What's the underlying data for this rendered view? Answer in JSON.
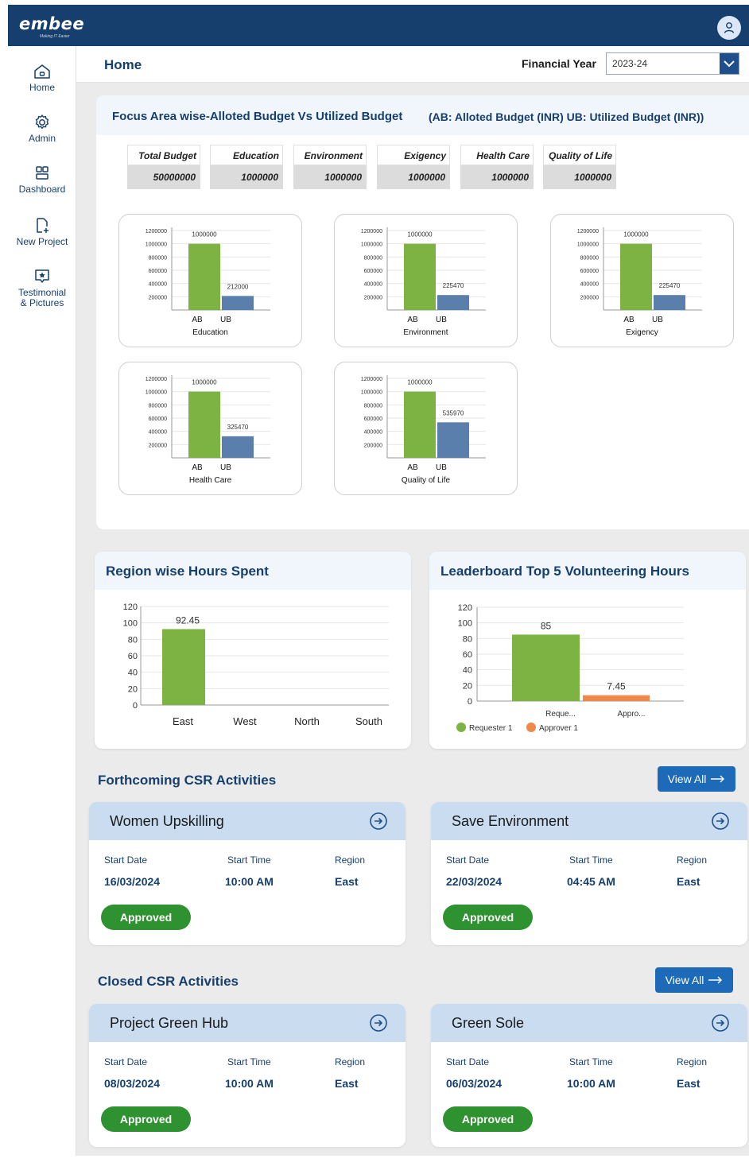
{
  "app": {
    "logo": "embee",
    "tagline": "Making IT Easier"
  },
  "sidebar": {
    "items": [
      {
        "label": "Home",
        "icon": "home-icon"
      },
      {
        "label": "Admin",
        "icon": "gear-icon"
      },
      {
        "label": "Dashboard",
        "icon": "dashboard-icon"
      },
      {
        "label": "New Project",
        "icon": "new-file-icon"
      },
      {
        "label": "Testimonial",
        "label2": "& Pictures",
        "icon": "star-message-icon"
      }
    ]
  },
  "header": {
    "title": "Home",
    "fy_label": "Financial Year",
    "fy_value": "2023-24"
  },
  "budget": {
    "title": "Focus Area wise-Alloted Budget Vs Utilized Budget",
    "legend": "(AB: Alloted Budget (INR)   UB: Utilized Budget (INR))",
    "tiles": [
      {
        "label": "Total Budget",
        "value": "50000000"
      },
      {
        "label": "Education",
        "value": "1000000"
      },
      {
        "label": "Environment",
        "value": "1000000"
      },
      {
        "label": "Exigency",
        "value": "1000000"
      },
      {
        "label": "Health Care",
        "value": "1000000"
      },
      {
        "label": "Quality of Life",
        "value": "1000000"
      }
    ]
  },
  "chart_data": [
    {
      "type": "bar",
      "title": "Education",
      "categories": [
        "AB",
        "UB"
      ],
      "values": [
        1000000,
        212000
      ],
      "ylim": [
        0,
        1200000
      ],
      "yticks": [
        "1200000",
        "1000000",
        "800000",
        "600000",
        "400000",
        "200000"
      ],
      "colors": [
        "#7cb342",
        "#5a7fad"
      ]
    },
    {
      "type": "bar",
      "title": "Environment",
      "categories": [
        "AB",
        "UB"
      ],
      "values": [
        1000000,
        225470
      ],
      "ylim": [
        0,
        1200000
      ],
      "yticks": [
        "1200000",
        "1000000",
        "800000",
        "600000",
        "400000",
        "200000"
      ],
      "colors": [
        "#7cb342",
        "#5a7fad"
      ]
    },
    {
      "type": "bar",
      "title": "Exigency",
      "categories": [
        "AB",
        "UB"
      ],
      "values": [
        1000000,
        225470
      ],
      "ylim": [
        0,
        1200000
      ],
      "yticks": [
        "1200000",
        "1000000",
        "800000",
        "600000",
        "400000",
        "200000"
      ],
      "colors": [
        "#7cb342",
        "#5a7fad"
      ]
    },
    {
      "type": "bar",
      "title": "Health Care",
      "categories": [
        "AB",
        "UB"
      ],
      "values": [
        1000000,
        325470
      ],
      "ylim": [
        0,
        1200000
      ],
      "yticks": [
        "1200000",
        "1000000",
        "800000",
        "600000",
        "400000",
        "200000"
      ],
      "colors": [
        "#7cb342",
        "#5a7fad"
      ]
    },
    {
      "type": "bar",
      "title": "Quality of Life",
      "categories": [
        "AB",
        "UB"
      ],
      "values": [
        1000000,
        535970
      ],
      "ylim": [
        0,
        1200000
      ],
      "yticks": [
        "1200000",
        "1000000",
        "800000",
        "600000",
        "400000",
        "200000"
      ],
      "colors": [
        "#7cb342",
        "#5a7fad"
      ]
    },
    {
      "type": "bar",
      "title": "Region wise Hours Spent",
      "categories": [
        "East",
        "West",
        "North",
        "South"
      ],
      "values": [
        92.45,
        0,
        0,
        0
      ],
      "value_labels": [
        "92.45",
        "",
        "",
        ""
      ],
      "ylim": [
        0,
        120
      ],
      "yticks": [
        "120",
        "100",
        "80",
        "60",
        "40",
        "20",
        "0"
      ],
      "colors": [
        "#7cb342"
      ]
    },
    {
      "type": "bar",
      "title": "Leaderboard Top 5 Volunteering Hours",
      "categories": [
        "Reque...",
        "Appro..."
      ],
      "values": [
        85,
        7.45
      ],
      "value_labels": [
        "85",
        "7.45"
      ],
      "ylim": [
        0,
        120
      ],
      "yticks": [
        "120",
        "100",
        "80",
        "60",
        "40",
        "20",
        "0"
      ],
      "colors": [
        "#7cb342",
        "#f0884a"
      ],
      "legend": [
        {
          "name": "Requester 1",
          "color": "#7cb342"
        },
        {
          "name": "Approver 1",
          "color": "#f0884a"
        }
      ]
    }
  ],
  "region_chart": {
    "title": "Region wise Hours Spent"
  },
  "leaderboard": {
    "title": "Leaderboard Top 5 Volunteering Hours"
  },
  "forthcoming": {
    "title": "Forthcoming CSR Activities",
    "view_all": "View All",
    "cards": [
      {
        "title": "Women Upskilling",
        "start_date_label": "Start Date",
        "start_date": "16/03/2024",
        "start_time_label": "Start Time",
        "start_time": "10:00 AM",
        "region_label": "Region",
        "region": "East",
        "status": "Approved"
      },
      {
        "title": "Save Environment",
        "start_date_label": "Start Date",
        "start_date": "22/03/2024",
        "start_time_label": "Start Time",
        "start_time": "04:45 AM",
        "region_label": "Region",
        "region": "East",
        "status": "Approved"
      }
    ]
  },
  "closed": {
    "title": "Closed CSR Activities",
    "view_all": "View All",
    "cards": [
      {
        "title": "Project Green Hub",
        "start_date_label": "Start Date",
        "start_date": "08/03/2024",
        "start_time_label": "Start Time",
        "start_time": "10:00 AM",
        "region_label": "Region",
        "region": "East",
        "status": "Approved"
      },
      {
        "title": "Green Sole",
        "start_date_label": "Start Date",
        "start_date": "06/03/2024",
        "start_time_label": "Start Time",
        "start_time": "10:00 AM",
        "region_label": "Region",
        "region": "East",
        "status": "Approved"
      }
    ]
  }
}
